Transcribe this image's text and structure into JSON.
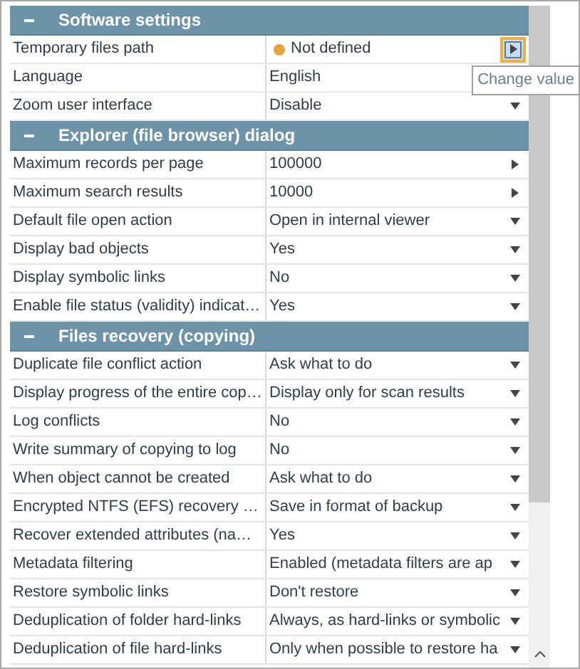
{
  "sections": [
    {
      "title": "Software settings",
      "expanded": true,
      "rows": [
        {
          "name": "Temporary files path",
          "value": "Not defined",
          "color": "#e8a33a",
          "kind": "arrow",
          "hovered": true,
          "tooltip": "Change value"
        },
        {
          "name": "Language",
          "value": "English",
          "kind": "plain",
          "hovered": false
        },
        {
          "name": "Zoom user interface",
          "value": "Disable",
          "kind": "dropdown",
          "hovered": false
        }
      ]
    },
    {
      "title": "Explorer (file browser) dialog",
      "expanded": true,
      "rows": [
        {
          "name": "Maximum records per page",
          "value": "100000",
          "kind": "arrow",
          "hovered": false
        },
        {
          "name": "Maximum search results",
          "value": "10000",
          "kind": "arrow",
          "hovered": false
        },
        {
          "name": "Default file open action",
          "value": "Open in internal viewer",
          "kind": "dropdown",
          "hovered": false
        },
        {
          "name": "Display bad objects",
          "value": "Yes",
          "kind": "dropdown",
          "hovered": false
        },
        {
          "name": "Display symbolic links",
          "value": "No",
          "kind": "dropdown",
          "hovered": false
        },
        {
          "name": "Enable file status (validity) indicat…",
          "value": "Yes",
          "kind": "dropdown",
          "hovered": false
        }
      ]
    },
    {
      "title": "Files recovery (copying)",
      "expanded": true,
      "rows": [
        {
          "name": "Duplicate file conflict action",
          "value": "Ask what to do",
          "kind": "dropdown",
          "hovered": false
        },
        {
          "name": "Display progress of the entire cop…",
          "value": "Display only for scan results",
          "kind": "dropdown",
          "hovered": false
        },
        {
          "name": "Log conflicts",
          "value": "No",
          "kind": "dropdown",
          "hovered": false
        },
        {
          "name": "Write summary of copying to log",
          "value": "No",
          "kind": "dropdown",
          "hovered": false
        },
        {
          "name": "When object cannot be created",
          "value": "Ask what to do",
          "kind": "dropdown",
          "hovered": false
        },
        {
          "name": "Encrypted NTFS (EFS) recovery …",
          "value": "Save in format of backup",
          "kind": "dropdown",
          "hovered": false
        },
        {
          "name": "Recover extended attributes (na…",
          "value": "Yes",
          "kind": "dropdown",
          "hovered": false
        },
        {
          "name": "Metadata filtering",
          "value": "Enabled (metadata filters are ap",
          "kind": "dropdown",
          "hovered": false
        },
        {
          "name": "Restore symbolic links",
          "value": "Don't restore",
          "kind": "dropdown",
          "hovered": false
        },
        {
          "name": "Deduplication of folder hard-links",
          "value": "Always, as hard-links or symbolic",
          "kind": "dropdown",
          "hovered": false
        },
        {
          "name": "Deduplication of file hard-links",
          "value": "Only when possible to restore ha",
          "kind": "dropdown",
          "hovered": false
        }
      ]
    }
  ]
}
